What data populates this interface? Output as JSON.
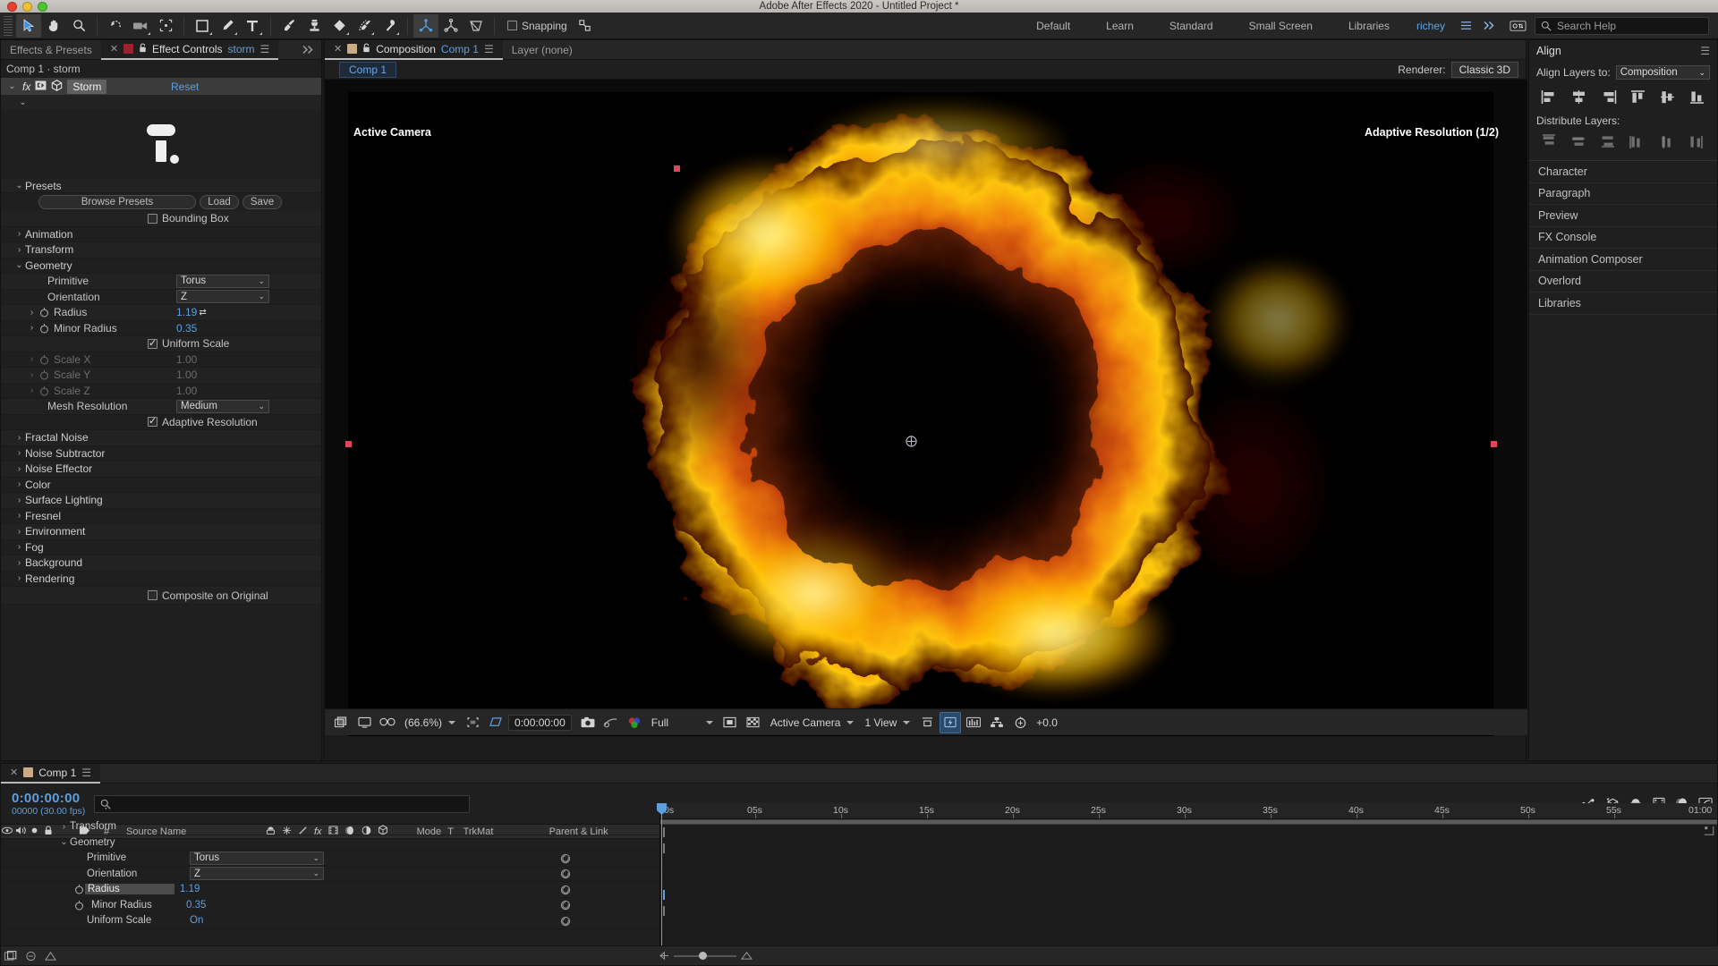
{
  "window": {
    "title": "Adobe After Effects 2020 - Untitled Project *"
  },
  "toolbar": {
    "tools": [
      {
        "name": "selection-tool",
        "glyph": "arrow",
        "selected": true
      },
      {
        "name": "hand-tool",
        "glyph": "hand",
        "selected": false
      },
      {
        "name": "zoom-tool",
        "glyph": "magnifier",
        "selected": false
      },
      {
        "name": "rotation-tool",
        "glyph": "rotate",
        "selected": false
      },
      {
        "name": "camera-tool",
        "glyph": "camera",
        "selected": false
      },
      {
        "name": "anchor-point-tool",
        "glyph": "anchor",
        "selected": false
      },
      {
        "name": "shape-tool",
        "glyph": "rect",
        "selected": false
      },
      {
        "name": "pen-tool",
        "glyph": "pen",
        "selected": false
      },
      {
        "name": "type-tool",
        "glyph": "type",
        "selected": false
      },
      {
        "name": "brush-tool",
        "glyph": "brush",
        "selected": false
      },
      {
        "name": "clone-stamp-tool",
        "glyph": "stamp",
        "selected": false
      },
      {
        "name": "eraser-tool",
        "glyph": "eraser",
        "selected": false
      },
      {
        "name": "roto-brush-tool",
        "glyph": "roto",
        "selected": false
      },
      {
        "name": "puppet-pin-tool",
        "glyph": "pin",
        "selected": false
      },
      {
        "name": "local-axis-mode",
        "glyph": "axis-local",
        "selected": true
      },
      {
        "name": "world-axis-mode",
        "glyph": "axis-world",
        "selected": false
      },
      {
        "name": "view-axis-mode",
        "glyph": "axis-view",
        "selected": false
      }
    ],
    "snapping_label": "Snapping",
    "snapping_checked": false,
    "workspaces": [
      "Default",
      "Learn",
      "Standard",
      "Small Screen",
      "Libraries"
    ],
    "user": "richey",
    "search_placeholder": "Search Help"
  },
  "effect_controls": {
    "tabs": [
      {
        "label": "Effects & Presets",
        "active": false
      },
      {
        "label": "Effect Controls",
        "suffix": "storm",
        "active": true
      }
    ],
    "path": "Comp 1 · storm",
    "effect_name": "Storm",
    "reset_label": "Reset",
    "presets": {
      "group_label": "Presets",
      "browse_label": "Browse Presets",
      "load_label": "Load",
      "save_label": "Save",
      "bounding_box_label": "Bounding Box",
      "bounding_box_checked": false
    },
    "groups_collapsed_top": [
      "Animation",
      "Transform"
    ],
    "geometry": {
      "group_label": "Geometry",
      "primitive_label": "Primitive",
      "primitive_value": "Torus",
      "orientation_label": "Orientation",
      "orientation_value": "Z",
      "radius_label": "Radius",
      "radius_value": "1.19",
      "minor_radius_label": "Minor Radius",
      "minor_radius_value": "0.35",
      "uniform_scale_label": "Uniform Scale",
      "uniform_scale_checked": true,
      "scale_x_label": "Scale X",
      "scale_x_value": "1.00",
      "scale_y_label": "Scale Y",
      "scale_y_value": "1.00",
      "scale_z_label": "Scale Z",
      "scale_z_value": "1.00",
      "mesh_resolution_label": "Mesh Resolution",
      "mesh_resolution_value": "Medium",
      "adaptive_resolution_label": "Adaptive Resolution",
      "adaptive_resolution_checked": true
    },
    "groups_collapsed_bottom": [
      "Fractal Noise",
      "Noise Subtractor",
      "Noise Effector",
      "Color",
      "Surface Lighting",
      "Fresnel",
      "Environment",
      "Fog",
      "Background",
      "Rendering"
    ],
    "composite_on_original_label": "Composite on Original",
    "composite_on_original_checked": false
  },
  "composition": {
    "tabs": [
      {
        "label": "Composition",
        "suffix": "Comp 1",
        "active": true
      },
      {
        "label": "Layer (none)",
        "active": false
      }
    ],
    "comp_chip": "Comp 1",
    "renderer_label": "Renderer:",
    "renderer_value": "Classic 3D",
    "overlay_left": "Active Camera",
    "overlay_right": "Adaptive Resolution (1/2)",
    "bottom_bar": {
      "magnification": "(66.6%)",
      "timecode": "0:00:00:00",
      "resolution": "Full",
      "view_layout": "1 View",
      "camera": "Active Camera",
      "exposure": "+0.0",
      "icons": [
        "always-preview-icon",
        "main-viewer-icon",
        "3d-glasses-icon",
        "region-of-interest-icon",
        "transparency-grid-icon",
        "snapshot-icon",
        "show-snapshot-icon",
        "channels-icon",
        "toggle-mask-icon",
        "toggle-alpha-icon",
        "3d-view-popup-icon",
        "pixel-aspect-icon",
        "fast-previews-icon",
        "timeline-icon",
        "comp-flowchart-icon",
        "reset-exposure-icon"
      ]
    }
  },
  "align_panel": {
    "title": "Align",
    "align_layers_to_label": "Align Layers to:",
    "align_layers_to_value": "Composition",
    "align_icons": [
      "align-left-icon",
      "align-horizontal-center-icon",
      "align-right-icon",
      "align-top-icon",
      "align-vertical-center-icon",
      "align-bottom-icon"
    ],
    "distribute_label": "Distribute Layers:",
    "distribute_icons": [
      "distribute-top-icon",
      "distribute-vertical-center-icon",
      "distribute-bottom-icon",
      "distribute-left-icon",
      "distribute-horizontal-center-icon",
      "distribute-right-icon"
    ],
    "collapsed_panels": [
      "Character",
      "Paragraph",
      "Preview",
      "FX Console",
      "Animation Composer",
      "Overlord",
      "Libraries"
    ]
  },
  "timeline": {
    "tab_label": "Comp 1",
    "current_time": "0:00:00:00",
    "frame_info": "00000 (30.00 fps)",
    "search_placeholder": "",
    "column_headers": [
      "#",
      "Source Name",
      "Mode",
      "T",
      "TrkMat",
      "Parent & Link"
    ],
    "switch_icons": [
      "video-eye-icon",
      "audio-icon",
      "solo-icon",
      "lock-icon",
      "label-icon"
    ],
    "layer_switch_icons": [
      "shy-icon",
      "collapse-transformations-icon",
      "quality-icon",
      "effects-fx-icon",
      "frame-blending-icon",
      "motion-blur-icon",
      "adjustment-layer-icon",
      "3d-layer-icon"
    ],
    "rows": [
      {
        "indent": 64,
        "twisty": "›",
        "name": "Transform",
        "value": "",
        "selected": false,
        "has_keyframe_col": true
      },
      {
        "indent": 64,
        "twisty": "⌄",
        "name": "Geometry",
        "value": "",
        "selected": false,
        "has_keyframe_col": true
      },
      {
        "indent": 96,
        "twisty": "",
        "name": "Primitive",
        "value": "Torus",
        "widget": "dropdown",
        "selected": false,
        "has_keyframe_col": true
      },
      {
        "indent": 96,
        "twisty": "",
        "name": "Orientation",
        "value": "Z",
        "widget": "dropdown",
        "selected": false,
        "has_keyframe_col": true
      },
      {
        "indent": 96,
        "twisty": "",
        "name": "Radius",
        "value": "1.19",
        "stopwatch": true,
        "selected": true,
        "has_keyframe_col": true
      },
      {
        "indent": 104,
        "twisty": "",
        "name": "Minor Radius",
        "value": "0.35",
        "stopwatch": true,
        "selected": false,
        "has_keyframe_col": true
      },
      {
        "indent": 96,
        "twisty": "",
        "name": "Uniform Scale",
        "value": "On",
        "selected": false,
        "has_keyframe_col": true
      }
    ],
    "ruler_ticks": [
      "0s",
      "05s",
      "10s",
      "15s",
      "20s",
      "25s",
      "30s",
      "35s",
      "40s",
      "45s",
      "50s",
      "55s",
      "01:00"
    ],
    "ruler_tick_positions": [
      0,
      6.7,
      13.4,
      20.1,
      26.8,
      33.5,
      40.2,
      46.9,
      53.6,
      60.3,
      67.0,
      73.7,
      80.4
    ],
    "zoom_icons": [
      "comp-button-icon",
      "hide-shy-icon",
      "frame-blending-switch-icon"
    ]
  },
  "colors": {
    "accent_blue": "#5d9fe0",
    "panel_bg": "#1f1f1f",
    "toolbar_bg": "#262626",
    "selection_red": "#e0455e",
    "fire_bright": "#ffdf00",
    "fire_mid": "#e8690a",
    "fire_dark": "#4a0d02"
  }
}
